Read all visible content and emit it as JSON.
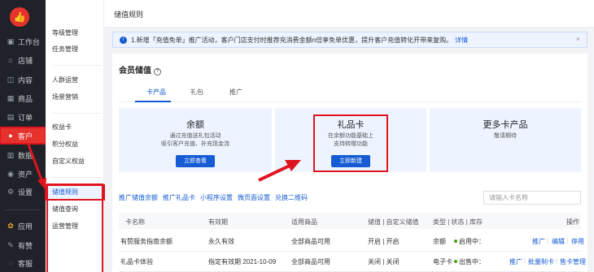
{
  "sidebar": {
    "items": [
      {
        "label": "工作台",
        "icon": "dashboard-icon"
      },
      {
        "label": "店铺",
        "icon": "store-icon"
      },
      {
        "label": "内容",
        "icon": "content-icon"
      },
      {
        "label": "商品",
        "icon": "goods-icon"
      },
      {
        "label": "订单",
        "icon": "order-icon"
      },
      {
        "label": "客户",
        "icon": "customer-icon"
      },
      {
        "label": "数据",
        "icon": "data-icon"
      },
      {
        "label": "资产",
        "icon": "asset-icon"
      },
      {
        "label": "设置",
        "icon": "settings-icon"
      },
      {
        "label": "应用",
        "icon": "apps-icon"
      },
      {
        "label": "有赞",
        "icon": "youzan-icon"
      },
      {
        "label": "客服",
        "icon": "service-icon"
      }
    ]
  },
  "subnav": {
    "items": [
      "等级管理",
      "任务管理",
      "人群运营",
      "场景营销",
      "权益卡",
      "积分权益",
      "自定义权益",
      "储值规则",
      "储值查询",
      "运营管理"
    ]
  },
  "page": {
    "title": "储值规则"
  },
  "notice": {
    "text": "1.新增「充值免单」推广活动，客户门店支付时推荐充消费金额n倍享免单优惠，提升客户充值转化开带来复购。",
    "link": "详情",
    "close": "×"
  },
  "section": {
    "title": "会员储值"
  },
  "tabs": [
    "卡产品",
    "礼包",
    "推广"
  ],
  "cards": [
    {
      "title": "余额",
      "desc1": "通过充值送礼包活动",
      "desc2": "吸引客户充值、补充现金流",
      "button": "立即查看"
    },
    {
      "title": "礼品卡",
      "desc1": "在余额功能基础上",
      "desc2": "支持转赠功能",
      "button": "立即新建"
    },
    {
      "title": "更多卡产品",
      "desc1": "敬请期待",
      "desc2": "",
      "button": ""
    }
  ],
  "links": [
    "推广储值余额",
    "推广礼品卡",
    "小程序设置",
    "微页面设置",
    "兑换二维码"
  ],
  "search": {
    "placeholder": "请输入卡名称"
  },
  "table": {
    "headers": [
      "卡名称",
      "有效期",
      "适用商品",
      "储值 | 自定义储值",
      "类型 | 状态 | 库存",
      "操作"
    ],
    "rows": [
      {
        "name": "有赞服务指南余额",
        "validity": "永久有效",
        "goods": "全部商品可用",
        "store": "开启 | 开启",
        "type": "余额",
        "status": "启用中：",
        "ops": [
          "推广",
          "编辑",
          "停用"
        ]
      },
      {
        "name": "礼品卡体验",
        "validity": "指定有效期 2021-10-09",
        "goods": "全部商品可用",
        "store": "关闭 | 关闭",
        "type": "电子卡",
        "status": "出售中：",
        "ops": [
          "推广",
          "批量制卡",
          "售卡管理"
        ]
      }
    ]
  },
  "colors": {
    "accent": "#155bd4",
    "brand": "#e5322d",
    "highlight": "#e0141e"
  }
}
